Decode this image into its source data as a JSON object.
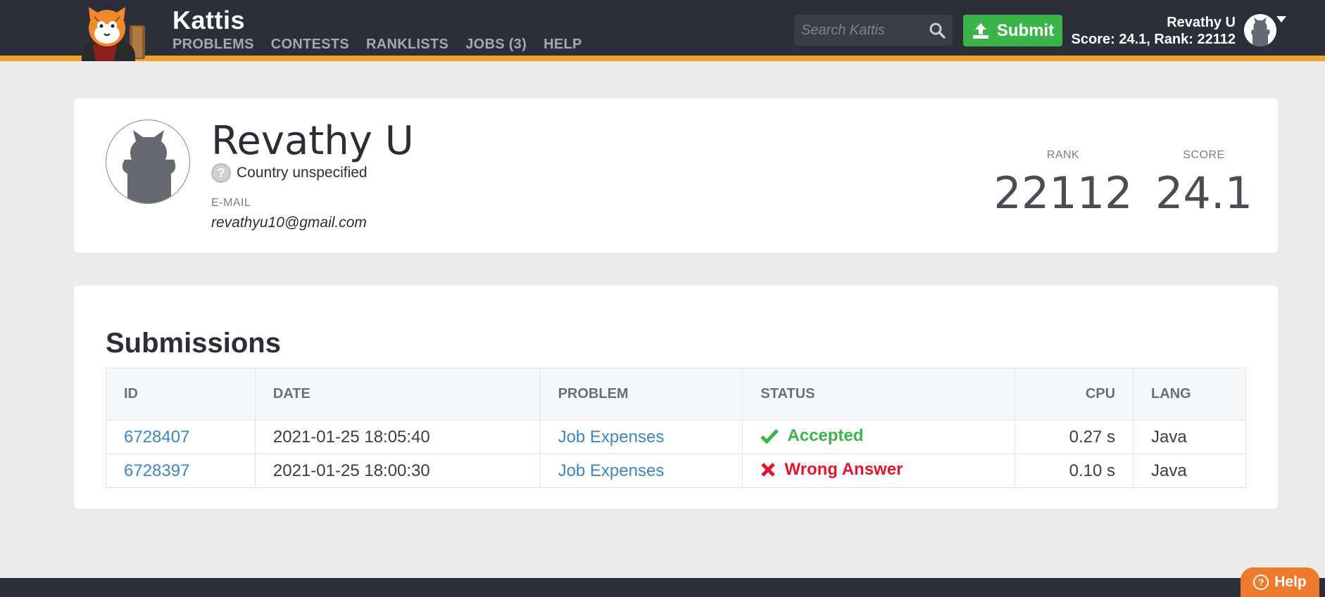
{
  "header": {
    "brand": "Kattis",
    "nav": [
      {
        "label": "PROBLEMS"
      },
      {
        "label": "CONTESTS"
      },
      {
        "label": "RANKLISTS"
      },
      {
        "label": "JOBS (3)"
      },
      {
        "label": "HELP"
      }
    ],
    "search_placeholder": "Search Kattis",
    "submit_label": "Submit",
    "user_name": "Revathy U",
    "user_stats": "Score: 24.1, Rank: 22112"
  },
  "profile": {
    "name": "Revathy U",
    "country": "Country unspecified",
    "country_icon": "question-icon",
    "email_label": "E-MAIL",
    "email": "revathyu10@gmail.com",
    "rank_label": "RANK",
    "rank": "22112",
    "score_label": "SCORE",
    "score": "24.1"
  },
  "submissions": {
    "title": "Submissions",
    "columns": [
      "ID",
      "DATE",
      "PROBLEM",
      "STATUS",
      "CPU",
      "LANG"
    ],
    "rows": [
      {
        "id": "6728407",
        "date": "2021-01-25 18:05:40",
        "problem": "Job Expenses",
        "status": "Accepted",
        "status_icon": "check-icon",
        "cpu": "0.27 s",
        "lang": "Java"
      },
      {
        "id": "6728397",
        "date": "2021-01-25 18:00:30",
        "problem": "Job Expenses",
        "status": "Wrong Answer",
        "status_icon": "x-icon",
        "cpu": "0.10 s",
        "lang": "Java"
      }
    ]
  },
  "help_button": "Help",
  "colors": {
    "header_bg": "#2c2f3a",
    "accent": "#f0a32a",
    "submit_green": "#3bb54a",
    "accepted": "#3bb54a",
    "wrong": "#e3162b",
    "link": "#3b87c7",
    "help_orange": "#ef7a2e"
  }
}
